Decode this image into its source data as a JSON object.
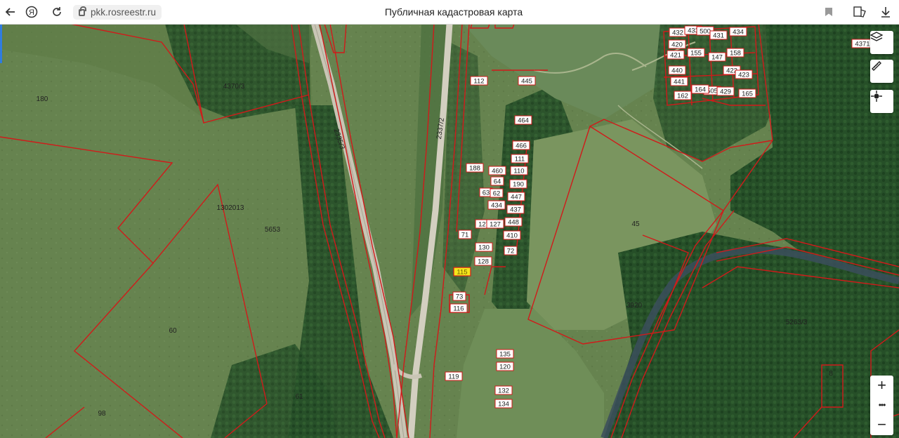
{
  "browser": {
    "url": "pkk.rosreestr.ru",
    "page_title": "Публичная кадастровая карта",
    "icons": [
      "back-arrow-icon",
      "yandex-icon",
      "reload-icon",
      "bookmark-icon",
      "reader-icon",
      "download-icon"
    ]
  },
  "map": {
    "controls": [
      "layers-icon",
      "ruler-icon",
      "locate-icon"
    ],
    "zoom_in": "+",
    "zoom_more": "•••",
    "zoom_out": "−",
    "plain_labels": [
      "180",
      "4370/3",
      "1302013",
      "5653",
      "60",
      "98",
      "61",
      "2335/3",
      "2337/2",
      "45",
      "3920",
      "5263/3",
      "8"
    ],
    "parcels": [
      "432",
      "433",
      "500",
      "431",
      "434",
      "420",
      "155",
      "147",
      "158",
      "421",
      "440",
      "422",
      "441",
      "505",
      "429",
      "423",
      "162",
      "164",
      "165",
      "4371",
      "112",
      "445",
      "464",
      "466",
      "111",
      "188",
      "460",
      "110",
      "64",
      "190",
      "63",
      "62",
      "447",
      "434",
      "437",
      "448",
      "127",
      "127",
      "410",
      "71",
      "130",
      "72",
      "128",
      "115",
      "73",
      "116",
      "135",
      "120",
      "119",
      "132",
      "134"
    ],
    "selected_parcel": "115",
    "colors": {
      "boundary": "#d11a1a",
      "selected_fill": "#f5e61c",
      "label_bg": "#ffffff"
    }
  }
}
